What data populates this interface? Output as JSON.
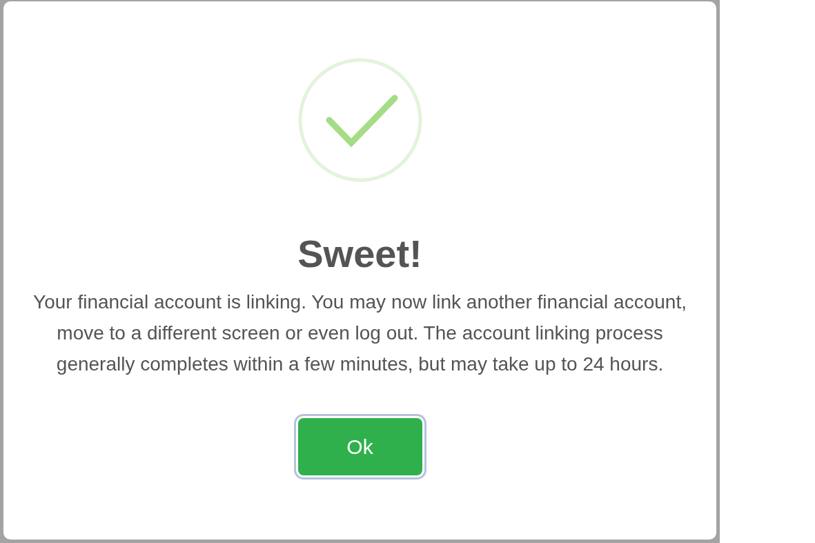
{
  "dialog": {
    "title": "Sweet!",
    "message": "Your financial account is linking. You may now link another financial account, move to a different screen or even log out. The account linking process generally completes within a few minutes, but may take up to 24 hours.",
    "buttons": [
      {
        "label": "Ok",
        "focused": true
      }
    ]
  }
}
